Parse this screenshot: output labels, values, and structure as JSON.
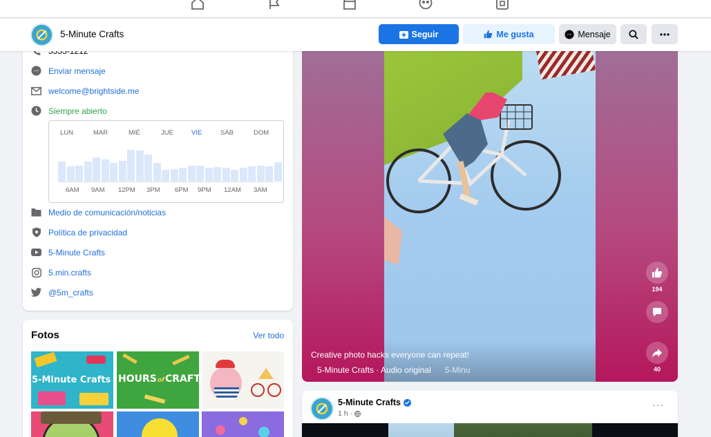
{
  "page": {
    "name": "5-Minute Crafts",
    "actions": {
      "follow": "Seguir",
      "like": "Me gusta",
      "message": "Mensaje"
    },
    "colors": {
      "primary": "#1b74e4",
      "link": "#216fdb",
      "open": "#31a24c"
    }
  },
  "topnav": {
    "icons": [
      "home-icon",
      "flag-icon",
      "marketplace-icon",
      "groups-icon",
      "gaming-icon"
    ]
  },
  "info": {
    "phone_partial": "5555-1212",
    "send_message": "Enviar mensaje",
    "email": "welcome@brightside.me",
    "hours_status": "Siempre abierto",
    "category": "Medio de comunicación/noticias",
    "privacy": "Política de privacidad",
    "youtube": "5-Minute Crafts",
    "instagram": "5.min.crafts",
    "twitter": "@5m_crafts"
  },
  "hours_chart": {
    "days": [
      "LUN",
      "MAR",
      "MIÉ",
      "JUE",
      "VIE",
      "SÁB",
      "DOM"
    ],
    "today": "VIE",
    "times": [
      "6AM",
      "9AM",
      "12PM",
      "3PM",
      "6PM",
      "9PM",
      "12AM",
      "3AM"
    ],
    "activity": [
      0.5,
      0.38,
      0.4,
      0.5,
      0.6,
      0.56,
      0.47,
      0.52,
      0.8,
      0.78,
      0.68,
      0.46,
      0.3,
      0.31,
      0.35,
      0.4,
      0.39,
      0.35,
      0.37,
      0.34,
      0.3,
      0.34,
      0.38,
      0.4,
      0.38,
      0.48
    ]
  },
  "photos": {
    "title": "Fotos",
    "see_all": "Ver todo",
    "thumbs": [
      {
        "text": "5-Minute Crafts"
      },
      {
        "text_a": "HOURS",
        "text_b": "of",
        "text_c": "CRAFTS"
      }
    ]
  },
  "video": {
    "caption": "Creative photo hacks everyone can repeat!",
    "audio": "5-Minute Crafts · Audio original",
    "audio_trail": "5-Minu",
    "likes": "194",
    "shares": "40"
  },
  "post": {
    "author": "5-Minute Crafts",
    "time": "1 h ·",
    "more": "···"
  }
}
